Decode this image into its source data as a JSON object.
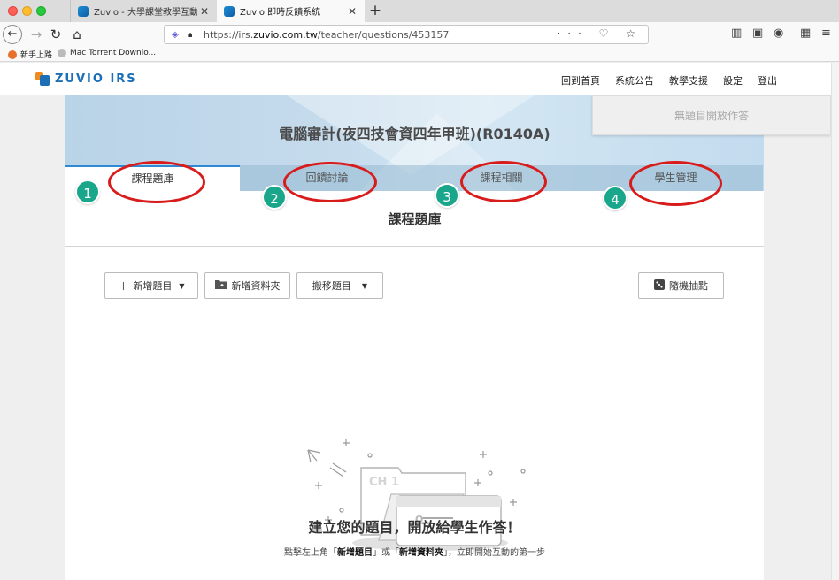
{
  "browser": {
    "tabs": [
      {
        "label": "Zuvio - 大學課堂教學互動工具",
        "close": "✕"
      },
      {
        "label": "Zuvio 即時反饋系統",
        "close": "✕"
      }
    ],
    "new_tab": "+",
    "url_prefix": "https://irs.",
    "url_domain": "zuvio.com.tw",
    "url_path": "/teacher/questions/453157",
    "url_actions": "··· ♡ ☆",
    "bookmarks": [
      {
        "label": "新手上路",
        "color": "#e8702a"
      },
      {
        "label": "Mac Torrent Downlo...",
        "color": "#bbbbbb"
      }
    ]
  },
  "site": {
    "logo_text": "ZUVIO IRS",
    "nav": [
      "回到首頁",
      "系統公告",
      "教學支援",
      "設定",
      "登出"
    ],
    "open_answer_button": "無題目開放作答",
    "course_title": "電腦審計(夜四技會資四年甲班)(R0140A)",
    "course_tabs": [
      "課程題庫",
      "回饋討論",
      "課程相關",
      "學生管理"
    ],
    "active_tab_index": 0,
    "content_title": "課程題庫",
    "buttons": {
      "add_question": "新增題目",
      "add_folder": "新增資料夾",
      "move_question": "搬移題目",
      "random_pick": "隨機抽點"
    },
    "illustration": {
      "folder_label": "CH 1",
      "card_label": "Q"
    },
    "empty_title": "建立您的題目，開放給學生作答！",
    "empty_sub_prefix": "點擊左上角「",
    "empty_sub_item1": "新增題目",
    "empty_sub_mid": "」或「",
    "empty_sub_item2": "新增資料夾",
    "empty_sub_suffix": "」，立即開始互動的第一步"
  },
  "annotations": {
    "badges": [
      "1",
      "2",
      "3",
      "4"
    ],
    "ring_color": "#d81b1b",
    "badge_color": "#1aa68a"
  },
  "colors": {
    "brand_blue": "#1c6fb6",
    "active_tab_border": "#2f8ad6",
    "banner": "#c6dced"
  }
}
